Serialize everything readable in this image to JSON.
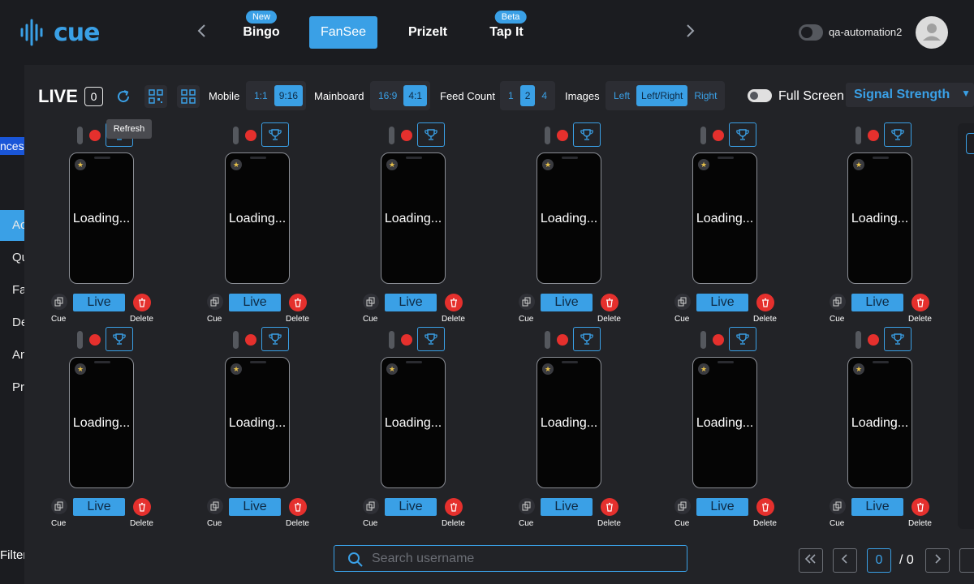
{
  "app": {
    "logo_text": "cue",
    "brand_color": "#3aa0e6"
  },
  "nav": {
    "tabs": [
      {
        "label": "Bingo",
        "badge": "New",
        "active": false
      },
      {
        "label": "FanSee",
        "badge": "",
        "active": true
      },
      {
        "label": "PrizeIt",
        "badge": "",
        "active": false
      },
      {
        "label": "Tap It",
        "badge": "Beta",
        "active": false
      }
    ],
    "prev_icon": "chevron-left-icon",
    "next_icon": "chevron-right-icon"
  },
  "user": {
    "name": "qa-automation2"
  },
  "sidebar": {
    "chip": "nces",
    "items": [
      {
        "label": "Ac",
        "active": true
      },
      {
        "label": "Qu",
        "active": false
      },
      {
        "label": "Fa",
        "active": false
      },
      {
        "label": "De",
        "active": false
      },
      {
        "label": "An",
        "active": false
      },
      {
        "label": "Pr",
        "active": false
      }
    ],
    "filter_label": "Filter"
  },
  "toolbar": {
    "live_label": "LIVE",
    "live_count": "0",
    "refresh_tooltip": "Refresh",
    "mobile_label": "Mobile",
    "mobile_options": [
      "1:1",
      "9:16"
    ],
    "mobile_selected": "9:16",
    "mainboard_label": "Mainboard",
    "mainboard_options": [
      "16:9",
      "4:1"
    ],
    "mainboard_selected": "4:1",
    "feed_count_label": "Feed Count",
    "feed_count_options": [
      "1",
      "2",
      "4"
    ],
    "feed_count_selected": "2",
    "images_label": "Images",
    "images_options": [
      "Left",
      "Left/Right",
      "Right"
    ],
    "images_selected": "Left/Right",
    "full_screen_label": "Full Screen",
    "signal_select_value": "Signal Strength"
  },
  "tile_labels": {
    "loading": "Loading...",
    "live_button": "Live",
    "cue_label": "Cue",
    "delete_label": "Delete"
  },
  "tiles_count": 12,
  "search": {
    "placeholder": "Search username",
    "value": ""
  },
  "pagination": {
    "current": "0",
    "total": "/ 0"
  },
  "colors": {
    "accent": "#3aa0e6",
    "danger": "#e5302d",
    "background": "#1b1c20",
    "panel": "#222327"
  }
}
